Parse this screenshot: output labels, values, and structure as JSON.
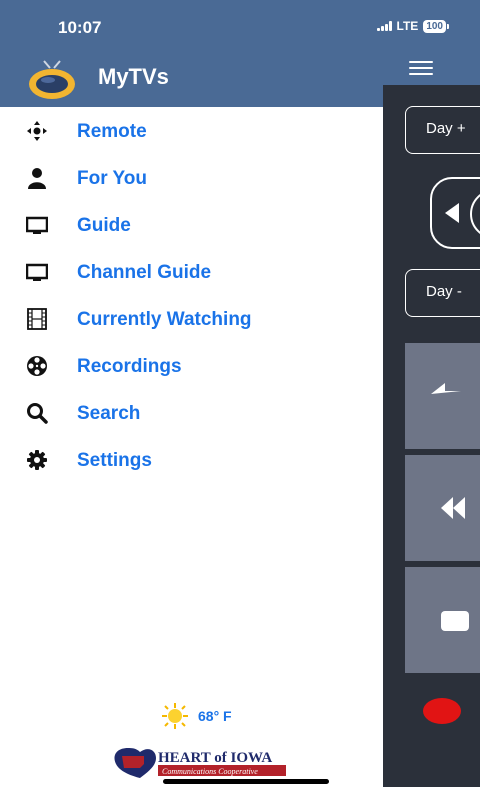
{
  "status_bar": {
    "time": "10:07",
    "network": "LTE",
    "battery": "100"
  },
  "header": {
    "title": "MyTVs"
  },
  "menu": {
    "items": [
      {
        "label": "Remote",
        "icon": "dpad-icon"
      },
      {
        "label": "For You",
        "icon": "person-icon"
      },
      {
        "label": "Guide",
        "icon": "tv-icon"
      },
      {
        "label": "Channel Guide",
        "icon": "tv-icon"
      },
      {
        "label": "Currently Watching",
        "icon": "film-strip-icon"
      },
      {
        "label": "Recordings",
        "icon": "film-reel-icon"
      },
      {
        "label": "Search",
        "icon": "magnifier-icon"
      },
      {
        "label": "Settings",
        "icon": "gear-icon"
      }
    ]
  },
  "remote_panel": {
    "day_plus_label": "Day +",
    "day_minus_label": "Day -"
  },
  "weather": {
    "temperature": "68° F",
    "icon": "sun-icon"
  },
  "partner": {
    "name_line1": "HEART of IOWA",
    "name_line2": "Communications Cooperative"
  },
  "colors": {
    "header_bg": "#4a6a95",
    "menu_text": "#1a73e8",
    "panel_bg": "#2b303a",
    "tile_bg": "#6e7587",
    "record": "#e11414"
  }
}
